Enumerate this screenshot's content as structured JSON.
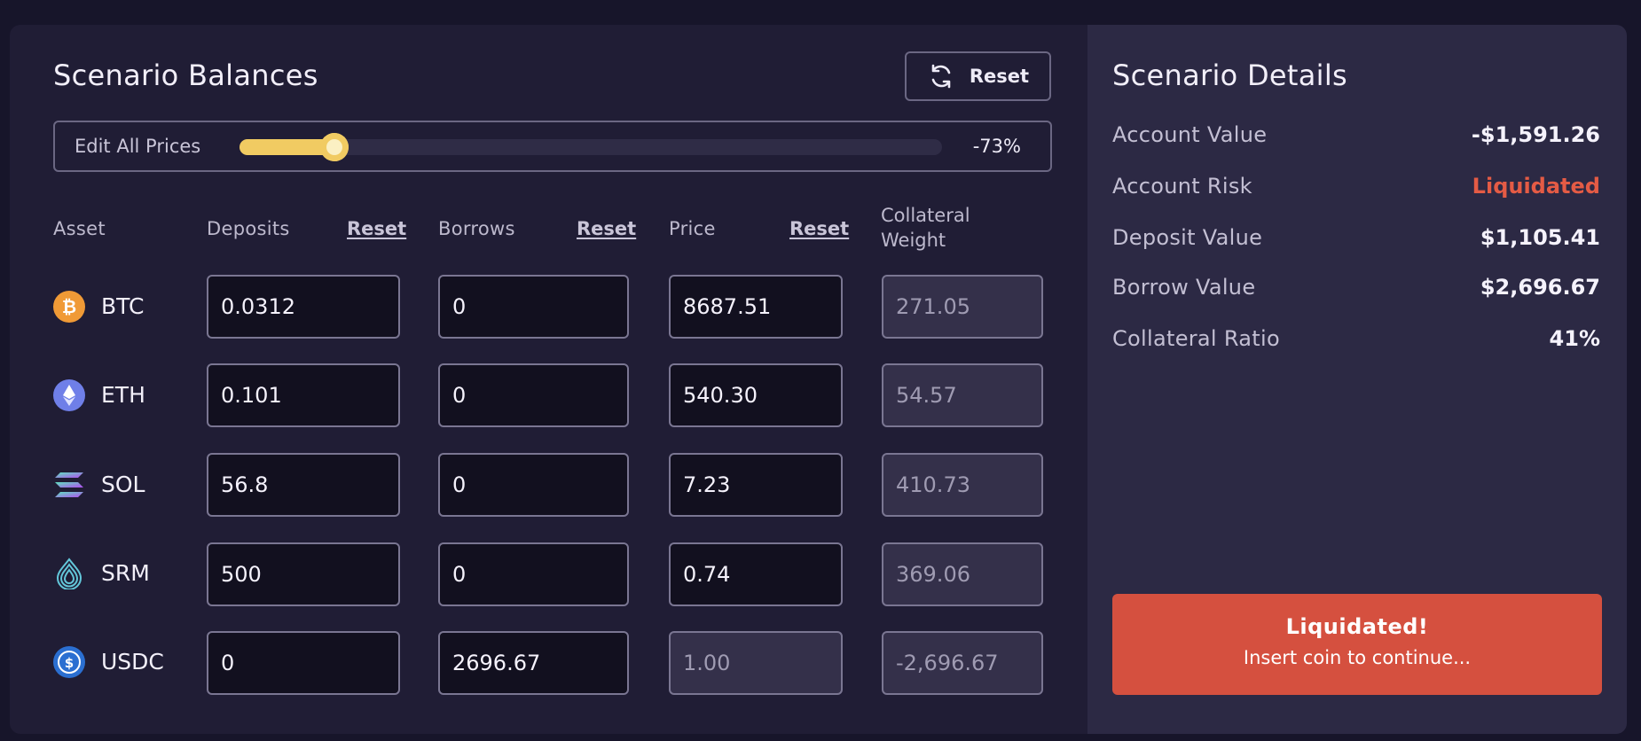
{
  "balances": {
    "title": "Scenario Balances",
    "reset_label": "Reset",
    "edit_all_prices": {
      "label": "Edit All Prices",
      "value_text": "-73%",
      "fill_fraction": 0.135
    },
    "headers": {
      "asset": "Asset",
      "deposits": "Deposits",
      "deposits_reset": "Reset",
      "borrows": "Borrows",
      "borrows_reset": "Reset",
      "price": "Price",
      "price_reset": "Reset",
      "collateral_line1": "Collateral",
      "collateral_line2": "Weight"
    },
    "rows": [
      {
        "asset": "BTC",
        "icon": "btc-icon",
        "deposits": "0.0312",
        "borrows": "0",
        "price": "8687.51",
        "collateral_weight": "271.05"
      },
      {
        "asset": "ETH",
        "icon": "eth-icon",
        "deposits": "0.101",
        "borrows": "0",
        "price": "540.30",
        "collateral_weight": "54.57"
      },
      {
        "asset": "SOL",
        "icon": "sol-icon",
        "deposits": "56.8",
        "borrows": "0",
        "price": "7.23",
        "collateral_weight": "410.73"
      },
      {
        "asset": "SRM",
        "icon": "srm-icon",
        "deposits": "500",
        "borrows": "0",
        "price": "0.74",
        "collateral_weight": "369.06"
      },
      {
        "asset": "USDC",
        "icon": "usdc-icon",
        "deposits": "0",
        "borrows": "2696.67",
        "price": "1.00",
        "collateral_weight": "-2,696.67"
      }
    ]
  },
  "details": {
    "title": "Scenario Details",
    "items": [
      {
        "label": "Account Value",
        "value": "-$1,591.26"
      },
      {
        "label": "Account Risk",
        "value": "Liquidated"
      },
      {
        "label": "Deposit Value",
        "value": "$1,105.41"
      },
      {
        "label": "Borrow Value",
        "value": "$2,696.67"
      },
      {
        "label": "Collateral Ratio",
        "value": "41%"
      }
    ],
    "alert": {
      "title": "Liquidated!",
      "subtitle": "Insert coin to continue..."
    }
  },
  "colors": {
    "accent_slider": "#f1cb62",
    "danger": "#d5503f",
    "danger_text": "#e45b45",
    "panel_left": "#201d35",
    "panel_right": "#2c2944"
  }
}
